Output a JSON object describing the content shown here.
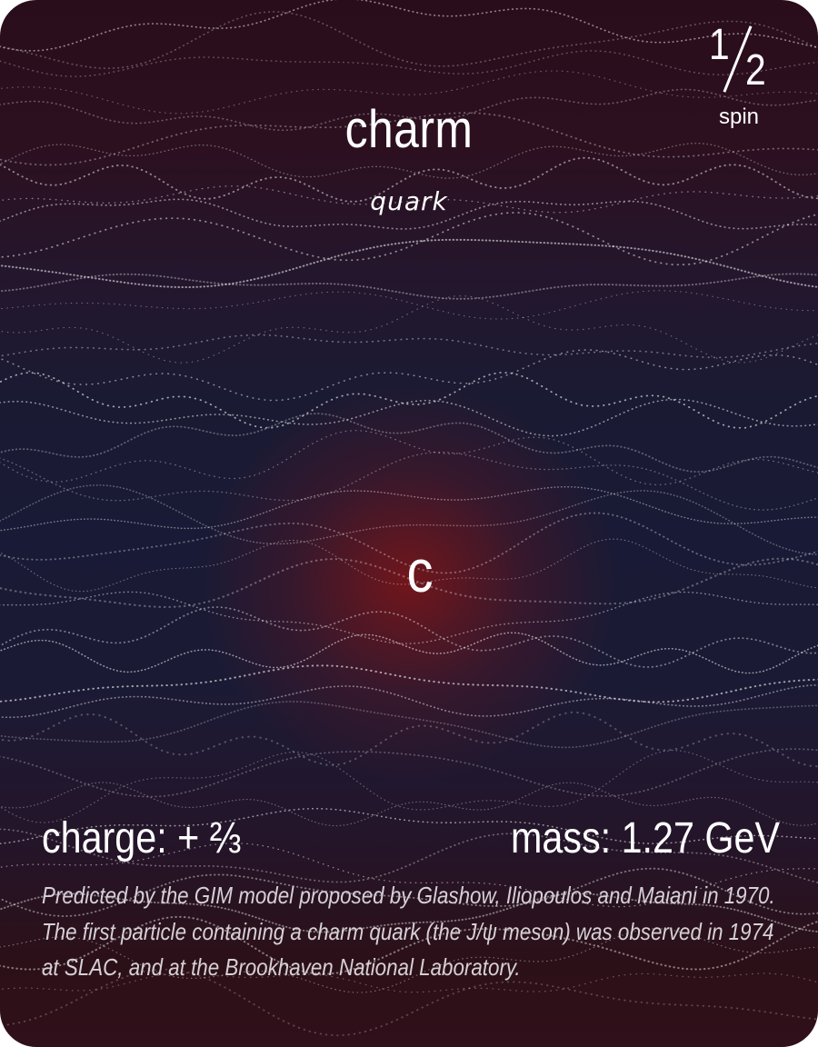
{
  "card": {
    "name": "charm",
    "category": "quark",
    "symbol": "c",
    "spin": {
      "numerator": "1",
      "denominator": "2",
      "label": "spin"
    },
    "charge": "charge: + ⅔",
    "mass": "mass: 1.27 GeV",
    "description": "Predicted by the GIM model proposed by Glashow, Iliopoulos and Maiani in 1970. The first particle containing a charm quark (the J/ψ meson) was observed in 1974 at SLAC, and at the Brookhaven National Laboratory."
  },
  "colors": {
    "background_top": "#2a0d1a",
    "background_middle": "#191a35",
    "background_bottom": "#30101a",
    "center_glow": "#76161a",
    "text": "#ffffff",
    "description_text": "#d6d0d6",
    "particle_dots": "#ffffff"
  }
}
